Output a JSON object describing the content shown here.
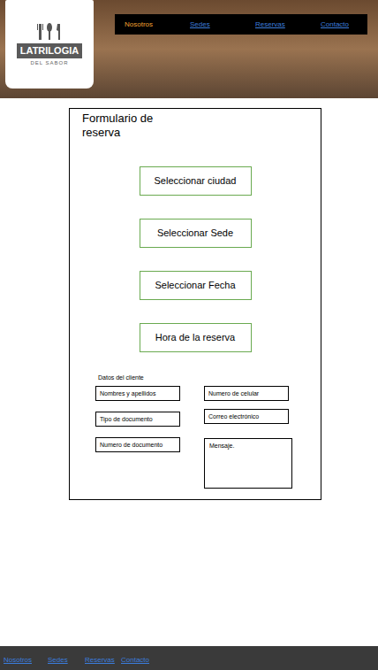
{
  "logo": {
    "title": "LATRILOGIA",
    "subtitle": "DEL SABOR"
  },
  "nav": [
    {
      "label": "Nosotros",
      "selected": true
    },
    {
      "label": "Sedes",
      "selected": false
    },
    {
      "label": "Reservas",
      "selected": false
    },
    {
      "label": "Contacto",
      "selected": false
    }
  ],
  "form": {
    "title": "Formulario de reserva",
    "selectors": [
      "Seleccionar ciudad",
      "Seleccionar Sede",
      "Seleccionar Fecha",
      "Hora de la reserva"
    ],
    "client_title": "Datos del cliente",
    "left_fields": [
      "Nombres y apellidos",
      "Tipo de documento",
      "Numero de documento"
    ],
    "right_fields": [
      "Numero de celular",
      "Correo electrónico"
    ],
    "message": "Mensaje."
  },
  "footer": [
    "Nosotros",
    "Sedes",
    "Reservas",
    "Contacto"
  ]
}
